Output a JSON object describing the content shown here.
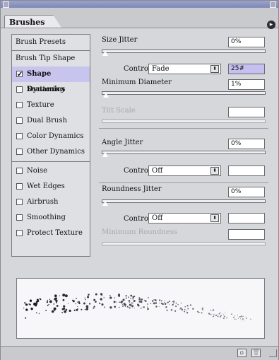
{
  "panel": {
    "tab_label": "Brushes",
    "menu_icon": "menu-arrow-icon"
  },
  "sidebar": {
    "items": [
      {
        "label": "Brush Presets",
        "checkbox": false,
        "checked": false,
        "selected": false
      },
      {
        "label": "Brush Tip Shape",
        "checkbox": false,
        "checked": false,
        "selected": false
      },
      {
        "label": "Shape Dynamics",
        "checkbox": true,
        "checked": true,
        "selected": true
      },
      {
        "label": "Scattering",
        "checkbox": true,
        "checked": false,
        "selected": false
      },
      {
        "label": "Texture",
        "checkbox": true,
        "checked": false,
        "selected": false
      },
      {
        "label": "Dual Brush",
        "checkbox": true,
        "checked": false,
        "selected": false
      },
      {
        "label": "Color Dynamics",
        "checkbox": true,
        "checked": false,
        "selected": false
      },
      {
        "label": "Other Dynamics",
        "checkbox": true,
        "checked": false,
        "selected": false
      },
      {
        "label": "Noise",
        "checkbox": true,
        "checked": false,
        "selected": false
      },
      {
        "label": "Wet Edges",
        "checkbox": true,
        "checked": false,
        "selected": false
      },
      {
        "label": "Airbrush",
        "checkbox": true,
        "checked": false,
        "selected": false
      },
      {
        "label": "Smoothing",
        "checkbox": true,
        "checked": false,
        "selected": false
      },
      {
        "label": "Protect Texture",
        "checkbox": true,
        "checked": false,
        "selected": false
      }
    ]
  },
  "settings": {
    "size_jitter": {
      "label": "Size Jitter",
      "value": "0%"
    },
    "size_control": {
      "label": "Control:",
      "value": "Fade",
      "steps": "25#"
    },
    "min_diameter": {
      "label": "Minimum Diameter",
      "value": "1%"
    },
    "tilt_scale": {
      "label": "Tilt Scale",
      "value": ""
    },
    "angle_jitter": {
      "label": "Angle Jitter",
      "value": "0%"
    },
    "angle_control": {
      "label": "Control:",
      "value": "Off",
      "extra": ""
    },
    "roundness_jitter": {
      "label": "Roundness Jitter",
      "value": "0%"
    },
    "roundness_control": {
      "label": "Control:",
      "value": "Off",
      "extra": ""
    },
    "min_roundness": {
      "label": "Minimum Roundness",
      "value": ""
    }
  },
  "footer": {
    "new_icon": "new-brush-icon",
    "delete_icon": "trash-icon"
  },
  "colors": {
    "selection": "#c7c5ee",
    "highlight_field": "#c4c0f0"
  }
}
